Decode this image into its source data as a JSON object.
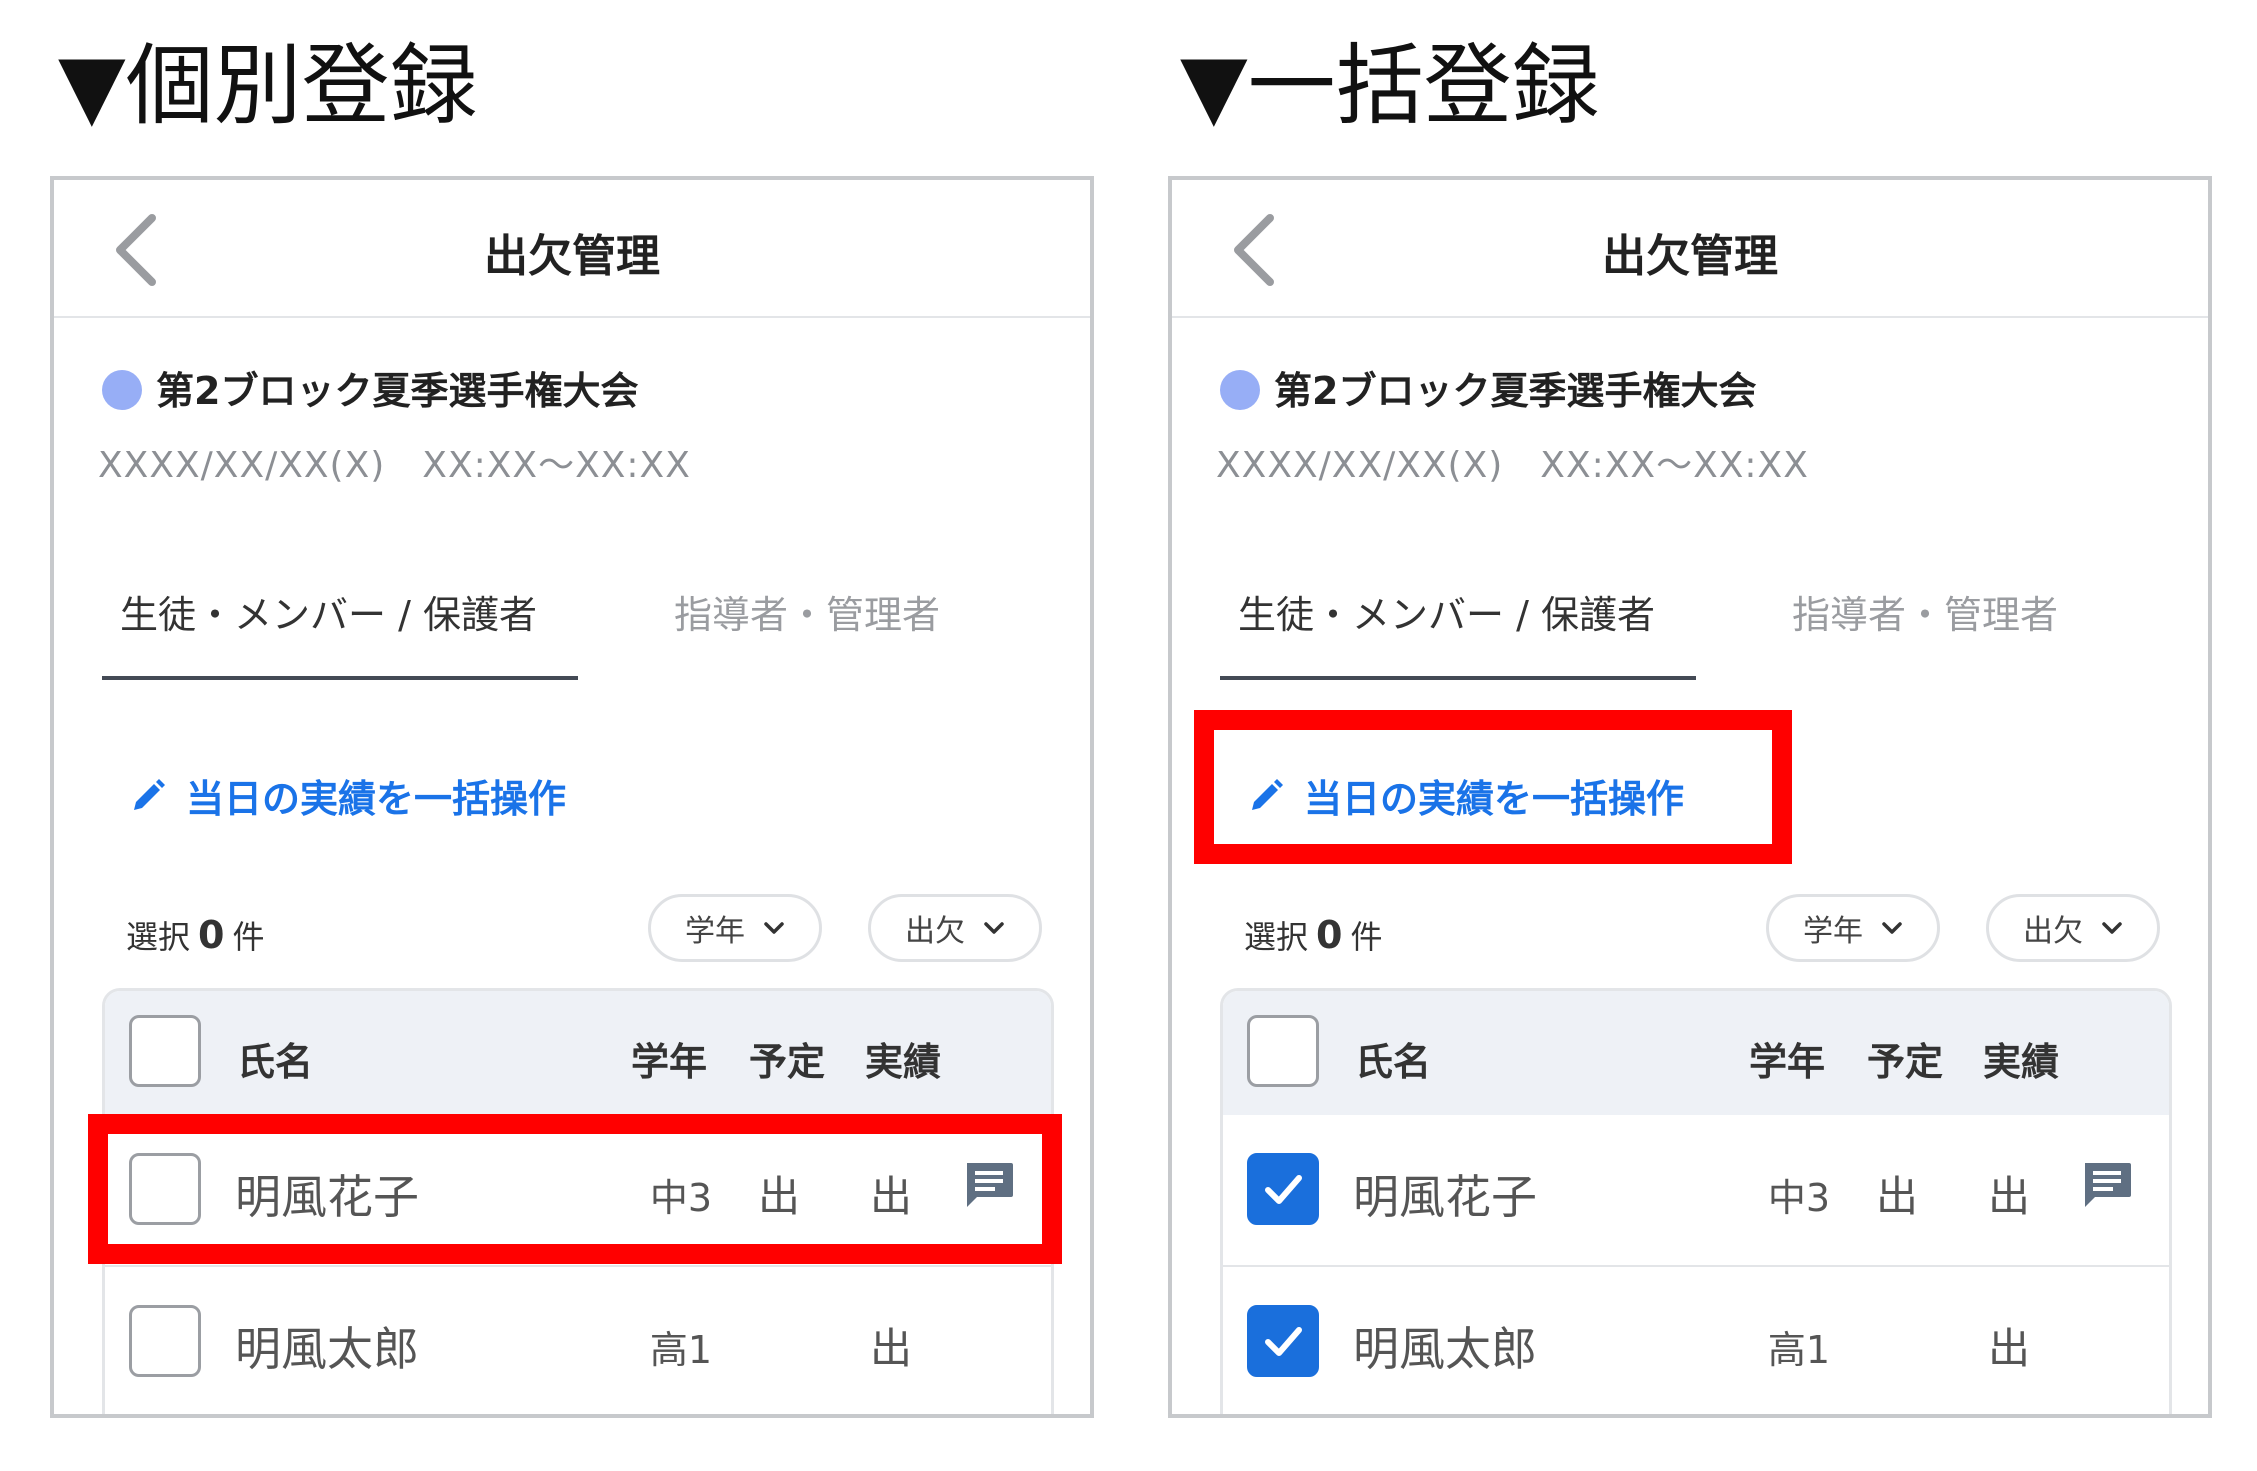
{
  "titles": {
    "left": "▼個別登録",
    "right": "▼一括登録"
  },
  "panel": {
    "title": "出欠管理",
    "event_name": "第2ブロック夏季選手権大会",
    "event_datetime": "XXXX/XX/XX(X)　XX:XX〜XX:XX",
    "tabs": [
      "生徒・メンバー / 保護者",
      "指導者・管理者"
    ],
    "active_tab": 0,
    "bulk_action": "当日の実績を一括操作",
    "selection": {
      "prefix": "選択",
      "count": "0",
      "suffix": "件"
    },
    "filters": [
      "学年",
      "出欠"
    ],
    "columns": {
      "name": "氏名",
      "grade": "学年",
      "plan": "予定",
      "actual": "実績"
    },
    "rows": [
      {
        "name": "明風花子",
        "grade": "中3",
        "plan": "出",
        "actual": "出",
        "has_memo": true
      },
      {
        "name": "明風太郎",
        "grade": "高1",
        "plan": "",
        "actual": "出",
        "has_memo": false
      }
    ]
  },
  "left_panel": {
    "rows_checked": [
      false,
      false
    ],
    "highlight": "row-1"
  },
  "right_panel": {
    "rows_checked": [
      true,
      true
    ],
    "highlight": "bulk-action"
  },
  "colors": {
    "highlight": "#ff0000",
    "accent": "#1a73e8",
    "checkbox_checked": "#1a6fdc",
    "event_dot": "#97aef6",
    "header_bg": "#eef1f6"
  },
  "icons": {
    "back": "chevron-left-icon",
    "bulk": "pencil-icon",
    "filter": "chevron-down-icon",
    "memo": "comment-icon",
    "checked": "checkmark-icon"
  }
}
